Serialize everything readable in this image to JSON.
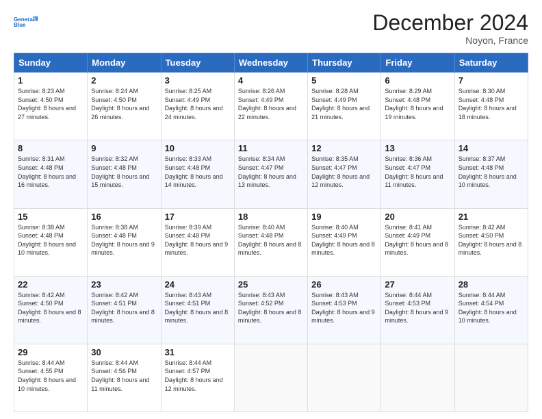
{
  "header": {
    "logo_line1": "General",
    "logo_line2": "Blue",
    "month": "December 2024",
    "location": "Noyon, France"
  },
  "days_of_week": [
    "Sunday",
    "Monday",
    "Tuesday",
    "Wednesday",
    "Thursday",
    "Friday",
    "Saturday"
  ],
  "weeks": [
    [
      {
        "num": "1",
        "sunrise": "8:23 AM",
        "sunset": "4:50 PM",
        "daylight": "8 hours and 27 minutes."
      },
      {
        "num": "2",
        "sunrise": "8:24 AM",
        "sunset": "4:50 PM",
        "daylight": "8 hours and 26 minutes."
      },
      {
        "num": "3",
        "sunrise": "8:25 AM",
        "sunset": "4:49 PM",
        "daylight": "8 hours and 24 minutes."
      },
      {
        "num": "4",
        "sunrise": "8:26 AM",
        "sunset": "4:49 PM",
        "daylight": "8 hours and 22 minutes."
      },
      {
        "num": "5",
        "sunrise": "8:28 AM",
        "sunset": "4:49 PM",
        "daylight": "8 hours and 21 minutes."
      },
      {
        "num": "6",
        "sunrise": "8:29 AM",
        "sunset": "4:48 PM",
        "daylight": "8 hours and 19 minutes."
      },
      {
        "num": "7",
        "sunrise": "8:30 AM",
        "sunset": "4:48 PM",
        "daylight": "8 hours and 18 minutes."
      }
    ],
    [
      {
        "num": "8",
        "sunrise": "8:31 AM",
        "sunset": "4:48 PM",
        "daylight": "8 hours and 16 minutes."
      },
      {
        "num": "9",
        "sunrise": "8:32 AM",
        "sunset": "4:48 PM",
        "daylight": "8 hours and 15 minutes."
      },
      {
        "num": "10",
        "sunrise": "8:33 AM",
        "sunset": "4:48 PM",
        "daylight": "8 hours and 14 minutes."
      },
      {
        "num": "11",
        "sunrise": "8:34 AM",
        "sunset": "4:47 PM",
        "daylight": "8 hours and 13 minutes."
      },
      {
        "num": "12",
        "sunrise": "8:35 AM",
        "sunset": "4:47 PM",
        "daylight": "8 hours and 12 minutes."
      },
      {
        "num": "13",
        "sunrise": "8:36 AM",
        "sunset": "4:47 PM",
        "daylight": "8 hours and 11 minutes."
      },
      {
        "num": "14",
        "sunrise": "8:37 AM",
        "sunset": "4:48 PM",
        "daylight": "8 hours and 10 minutes."
      }
    ],
    [
      {
        "num": "15",
        "sunrise": "8:38 AM",
        "sunset": "4:48 PM",
        "daylight": "8 hours and 10 minutes."
      },
      {
        "num": "16",
        "sunrise": "8:38 AM",
        "sunset": "4:48 PM",
        "daylight": "8 hours and 9 minutes."
      },
      {
        "num": "17",
        "sunrise": "8:39 AM",
        "sunset": "4:48 PM",
        "daylight": "8 hours and 9 minutes."
      },
      {
        "num": "18",
        "sunrise": "8:40 AM",
        "sunset": "4:48 PM",
        "daylight": "8 hours and 8 minutes."
      },
      {
        "num": "19",
        "sunrise": "8:40 AM",
        "sunset": "4:49 PM",
        "daylight": "8 hours and 8 minutes."
      },
      {
        "num": "20",
        "sunrise": "8:41 AM",
        "sunset": "4:49 PM",
        "daylight": "8 hours and 8 minutes."
      },
      {
        "num": "21",
        "sunrise": "8:42 AM",
        "sunset": "4:50 PM",
        "daylight": "8 hours and 8 minutes."
      }
    ],
    [
      {
        "num": "22",
        "sunrise": "8:42 AM",
        "sunset": "4:50 PM",
        "daylight": "8 hours and 8 minutes."
      },
      {
        "num": "23",
        "sunrise": "8:42 AM",
        "sunset": "4:51 PM",
        "daylight": "8 hours and 8 minutes."
      },
      {
        "num": "24",
        "sunrise": "8:43 AM",
        "sunset": "4:51 PM",
        "daylight": "8 hours and 8 minutes."
      },
      {
        "num": "25",
        "sunrise": "8:43 AM",
        "sunset": "4:52 PM",
        "daylight": "8 hours and 8 minutes."
      },
      {
        "num": "26",
        "sunrise": "8:43 AM",
        "sunset": "4:53 PM",
        "daylight": "8 hours and 9 minutes."
      },
      {
        "num": "27",
        "sunrise": "8:44 AM",
        "sunset": "4:53 PM",
        "daylight": "8 hours and 9 minutes."
      },
      {
        "num": "28",
        "sunrise": "8:44 AM",
        "sunset": "4:54 PM",
        "daylight": "8 hours and 10 minutes."
      }
    ],
    [
      {
        "num": "29",
        "sunrise": "8:44 AM",
        "sunset": "4:55 PM",
        "daylight": "8 hours and 10 minutes."
      },
      {
        "num": "30",
        "sunrise": "8:44 AM",
        "sunset": "4:56 PM",
        "daylight": "8 hours and 11 minutes."
      },
      {
        "num": "31",
        "sunrise": "8:44 AM",
        "sunset": "4:57 PM",
        "daylight": "8 hours and 12 minutes."
      },
      null,
      null,
      null,
      null
    ]
  ],
  "labels": {
    "sunrise": "Sunrise:",
    "sunset": "Sunset:",
    "daylight": "Daylight:"
  }
}
